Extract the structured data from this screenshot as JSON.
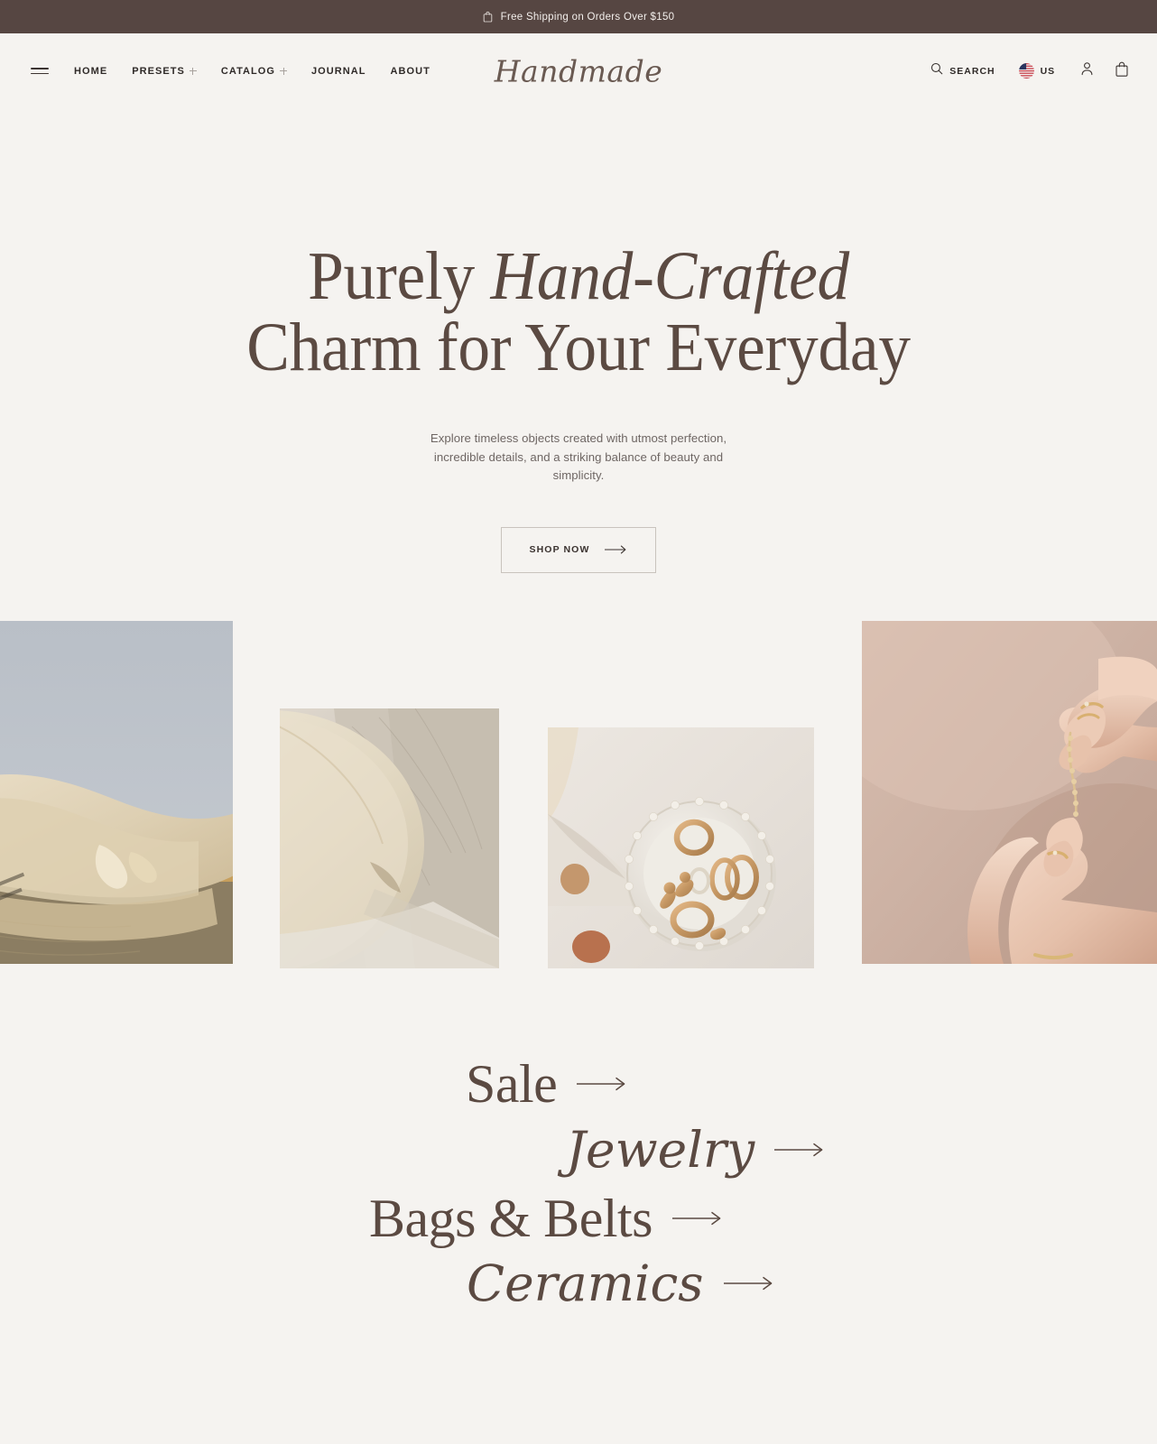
{
  "announcement": {
    "icon": "shopping-bag-icon",
    "text": "Free Shipping on Orders Over $150",
    "background": "#564642",
    "text_color": "#f3efec"
  },
  "header": {
    "menu_icon": "hamburger-icon",
    "logo": "Handmade",
    "nav": [
      {
        "label": "HOME",
        "has_dropdown": false
      },
      {
        "label": "PRESETS",
        "has_dropdown": true
      },
      {
        "label": "CATALOG",
        "has_dropdown": true
      },
      {
        "label": "JOURNAL",
        "has_dropdown": false
      },
      {
        "label": "ABOUT",
        "has_dropdown": false
      }
    ],
    "search": {
      "icon": "search-icon",
      "label": "SEARCH"
    },
    "locale": {
      "icon": "us-flag-icon",
      "label": "US"
    },
    "account_icon": "user-icon",
    "cart_icon": "shopping-bag-icon"
  },
  "hero": {
    "title_part1": "Purely ",
    "title_emphasis": "Hand-Crafted",
    "title_part2": "Charm for Your Everyday",
    "subtitle": "Explore timeless objects created with utmost perfection, incredible details, and a striking balance of beauty and simplicity.",
    "cta_label": "SHOP NOW",
    "cta_icon": "arrow-right-icon",
    "heading_color": "#5b4a42",
    "background": "#f5f3f0"
  },
  "gallery": [
    {
      "name": "linen-cloth-on-table"
    },
    {
      "name": "ceramic-plate-with-linen"
    },
    {
      "name": "gold-rings-on-ceramic-dish"
    },
    {
      "name": "hands-holding-gold-chain"
    }
  ],
  "categories": [
    {
      "label": "Sale",
      "style": "serif",
      "icon": "arrow-right-icon"
    },
    {
      "label": "Jewelry",
      "style": "script",
      "icon": "arrow-right-icon"
    },
    {
      "label": "Bags & Belts",
      "style": "serif",
      "icon": "arrow-right-icon"
    },
    {
      "label": "Ceramics",
      "style": "script",
      "icon": "arrow-right-icon"
    }
  ]
}
